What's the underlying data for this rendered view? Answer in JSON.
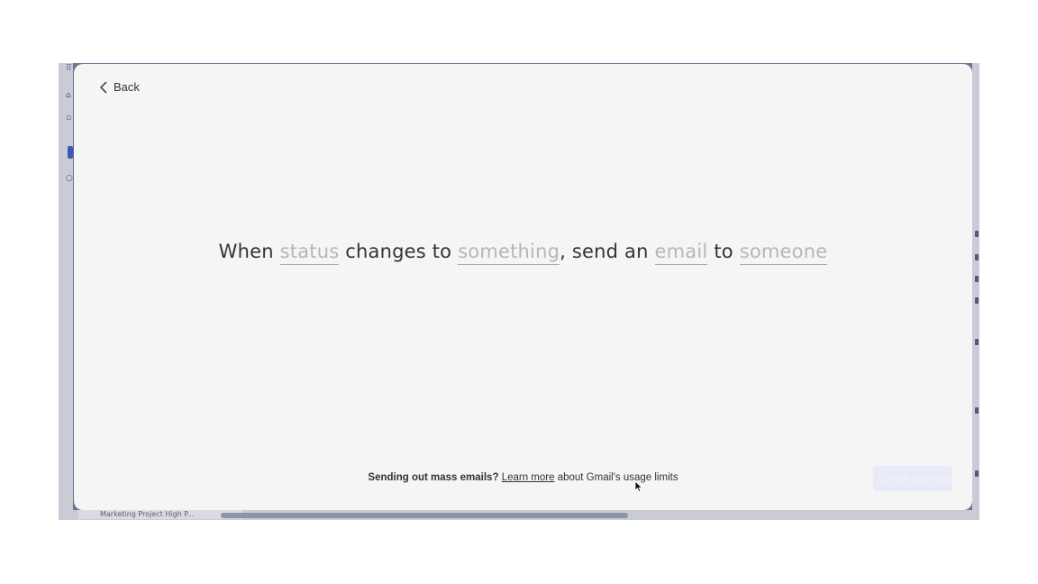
{
  "background_app": {
    "bottom_tab_label": "Marketing Project High P..."
  },
  "modal": {
    "back_label": "Back",
    "sentence": {
      "w1": "When",
      "trigger_column": "status",
      "w2": "changes to",
      "trigger_value": "something",
      "w3": ", send an",
      "action_type": "email",
      "w4": "to",
      "recipient": "someone"
    },
    "footer": {
      "question": "Sending out mass emails?",
      "link": "Learn more",
      "suffix": "about Gmail's usage limits"
    },
    "create_button_label": "Create automation"
  },
  "colors": {
    "modal_bg": "#f5f5f6",
    "overlay": "#6e7290",
    "placeholder_text": "#b5b6bd",
    "text": "#323338"
  },
  "icons": [
    "chevron-left-icon",
    "mouse-pointer-icon"
  ]
}
